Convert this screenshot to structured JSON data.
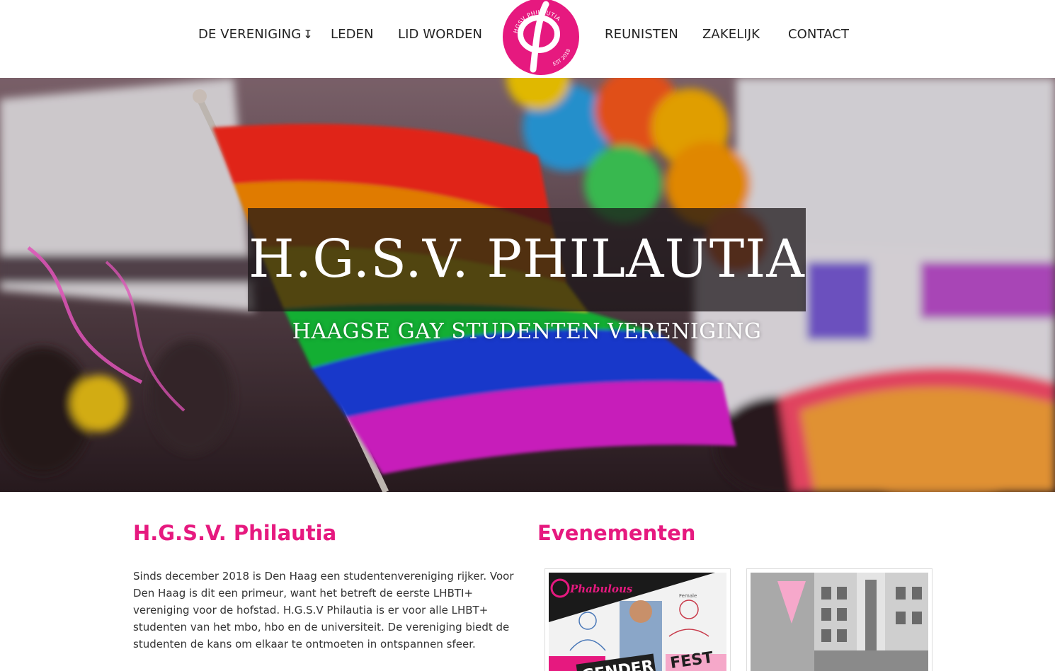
{
  "nav": {
    "left": [
      {
        "label": "DE VERENIGING",
        "arrow": "↧"
      },
      {
        "label": "LEDEN"
      },
      {
        "label": "LID WORDEN"
      }
    ],
    "right": [
      {
        "label": "REUNISTEN"
      },
      {
        "label": "ZAKELIJK"
      },
      {
        "label": "CONTACT"
      }
    ],
    "logo": {
      "ring_text_top": "HGSV PHILAUTIA",
      "ring_text_bottom": "EST 2018",
      "color": "#e6197f"
    }
  },
  "hero": {
    "title": "H.G.S.V. PHILAUTIA",
    "subtitle": "HAAGSE GAY STUDENTEN VERENIGING"
  },
  "about": {
    "heading": "H.G.S.V. Philautia",
    "text": "Sinds december 2018 is Den Haag een studentenvereniging rijker. Voor Den Haag is dit een primeur, want het betreft de eerste LHBTI+ vereniging voor de hofstad. H.G.S.V Philautia is er voor alle LHBT+ studenten van het mbo, hbo en de universiteit. De vereniging biedt de studenten de kans om elkaar te ontmoeten in ontspannen sfeer."
  },
  "events": {
    "heading": "Evenementen",
    "cards": [
      {
        "image": "phabulous-gender-fest-poster",
        "poster_lines": [
          "Phabulous",
          "GENDER",
          "FEST"
        ]
      },
      {
        "image": "pink-triangle-building-photo"
      }
    ]
  },
  "colors": {
    "accent": "#e6197f"
  }
}
